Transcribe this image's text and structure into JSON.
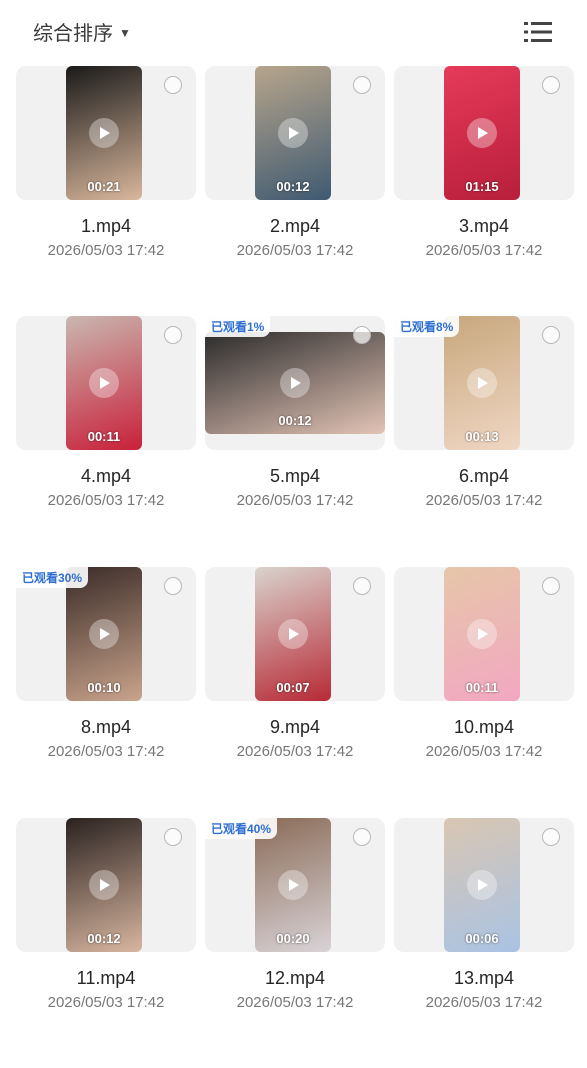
{
  "header": {
    "sort_label": "综合排序",
    "sort_icon": "caret-down-icon",
    "view_toggle_icon": "list-view-icon"
  },
  "items": [
    {
      "name": "1.mp4",
      "date": "2026/05/03 17:42",
      "duration": "00:21",
      "badge": "",
      "orientation": "portrait",
      "colors": [
        "#1a1a1a",
        "#d9b79c"
      ]
    },
    {
      "name": "2.mp4",
      "date": "2026/05/03 17:42",
      "duration": "00:12",
      "badge": "",
      "orientation": "portrait",
      "colors": [
        "#b7a58b",
        "#3f5a72"
      ]
    },
    {
      "name": "3.mp4",
      "date": "2026/05/03 17:42",
      "duration": "01:15",
      "badge": "",
      "orientation": "portrait",
      "colors": [
        "#e63a5a",
        "#b81f3a"
      ]
    },
    {
      "name": "4.mp4",
      "date": "2026/05/03 17:42",
      "duration": "00:11",
      "badge": "",
      "orientation": "portrait",
      "colors": [
        "#c9b7b0",
        "#c9203a"
      ]
    },
    {
      "name": "5.mp4",
      "date": "2026/05/03 17:42",
      "duration": "00:12",
      "badge": "已观看1%",
      "orientation": "landscape",
      "colors": [
        "#2b2b2b",
        "#e3c4b6"
      ]
    },
    {
      "name": "6.mp4",
      "date": "2026/05/03 17:42",
      "duration": "00:13",
      "badge": "已观看8%",
      "orientation": "portrait",
      "colors": [
        "#c7a77c",
        "#f0d7c4"
      ]
    },
    {
      "name": "8.mp4",
      "date": "2026/05/03 17:42",
      "duration": "00:10",
      "badge": "已观看30%",
      "orientation": "portrait",
      "colors": [
        "#3a2b28",
        "#c9a48c"
      ]
    },
    {
      "name": "9.mp4",
      "date": "2026/05/03 17:42",
      "duration": "00:07",
      "badge": "",
      "orientation": "portrait",
      "colors": [
        "#d9d3cd",
        "#b72a36"
      ]
    },
    {
      "name": "10.mp4",
      "date": "2026/05/03 17:42",
      "duration": "00:11",
      "badge": "",
      "orientation": "portrait",
      "colors": [
        "#e6c6a8",
        "#f2a7c2"
      ]
    },
    {
      "name": "11.mp4",
      "date": "2026/05/03 17:42",
      "duration": "00:12",
      "badge": "",
      "orientation": "portrait",
      "colors": [
        "#2a2220",
        "#d8b6a0"
      ]
    },
    {
      "name": "12.mp4",
      "date": "2026/05/03 17:42",
      "duration": "00:20",
      "badge": "已观看40%",
      "orientation": "portrait",
      "colors": [
        "#8a6b57",
        "#d9d3d7"
      ]
    },
    {
      "name": "13.mp4",
      "date": "2026/05/03 17:42",
      "duration": "00:06",
      "badge": "",
      "orientation": "portrait",
      "colors": [
        "#d9c6b2",
        "#a9c3e4"
      ]
    }
  ]
}
